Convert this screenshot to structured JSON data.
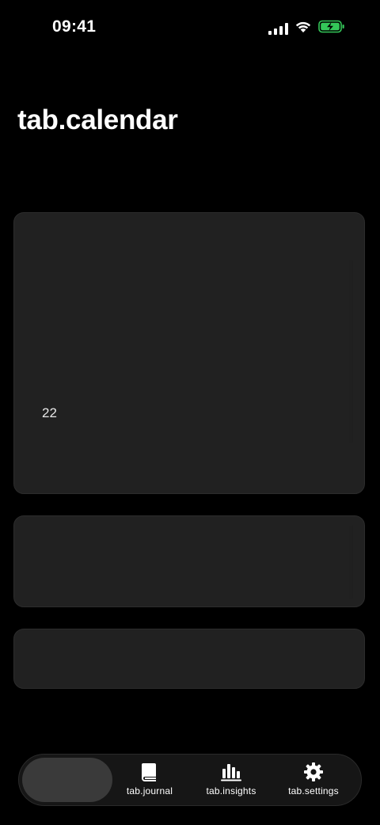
{
  "status_bar": {
    "time": "09:41"
  },
  "page": {
    "title": "tab.calendar"
  },
  "calendar_card": {
    "day": "22"
  },
  "tab_bar": {
    "items": [
      {
        "id": "calendar",
        "label": "",
        "icon": "calendar-icon",
        "active": true
      },
      {
        "id": "journal",
        "label": "tab.journal",
        "icon": "book-icon",
        "active": false
      },
      {
        "id": "insights",
        "label": "tab.insights",
        "icon": "chart-bars-icon",
        "active": false
      },
      {
        "id": "settings",
        "label": "tab.settings",
        "icon": "gear-icon",
        "active": false
      }
    ]
  },
  "colors": {
    "background": "#000000",
    "card": "#212121",
    "tab_bar": "#161616",
    "active_pill": "#3a3a3a",
    "battery_green": "#34c759"
  }
}
